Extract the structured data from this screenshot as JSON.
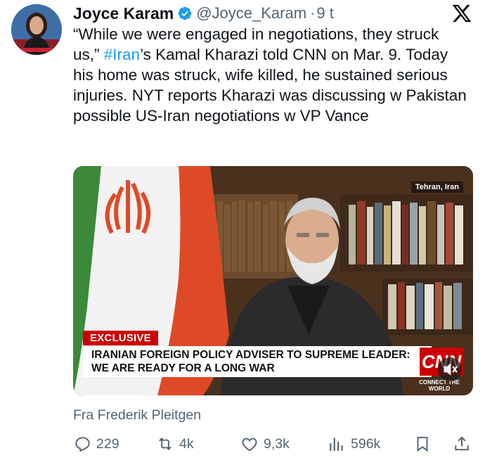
{
  "author": {
    "display_name": "Joyce Karam",
    "handle": "@Joyce_Karam",
    "separator": "·",
    "timestamp": "9 t"
  },
  "tweet": {
    "text_before_hashtag": "“While we were engaged in negotiations, they struck us,” ",
    "hashtag": "#Iran",
    "text_after_hashtag": "’s Kamal Kharazi told CNN on Mar. 9. Today his home was struck, wife killed, he sustained serious injuries. NYT reports Kharazi was discussing w Pakistan possible US-Iran negotiations w VP Vance"
  },
  "media": {
    "location_tag": "Tehran, Iran",
    "exclusive_label": "EXCLUSIVE",
    "headline": "IRANIAN FOREIGN POLICY ADVISER TO SUPREME LEADER: WE ARE READY FOR A LONG WAR",
    "network_logo": "CNN",
    "network_subtitle": "CONNECT THE WORLD"
  },
  "source": {
    "text": "Fra Frederik Pleitgen"
  },
  "actions": {
    "replies": "229",
    "reposts": "4k",
    "likes": "9,3k",
    "views": "596k"
  },
  "colors": {
    "accent": "#1d9bf0",
    "text": "#0f1419",
    "secondary": "#536471",
    "cnn_red": "#cc0000"
  },
  "icons": {
    "verified": "verified-badge-icon",
    "x_logo": "x-logo-icon",
    "reply": "reply-icon",
    "repost": "repost-icon",
    "like": "heart-icon",
    "views": "views-icon",
    "bookmark": "bookmark-icon",
    "share": "share-icon",
    "mute": "mute-icon"
  }
}
